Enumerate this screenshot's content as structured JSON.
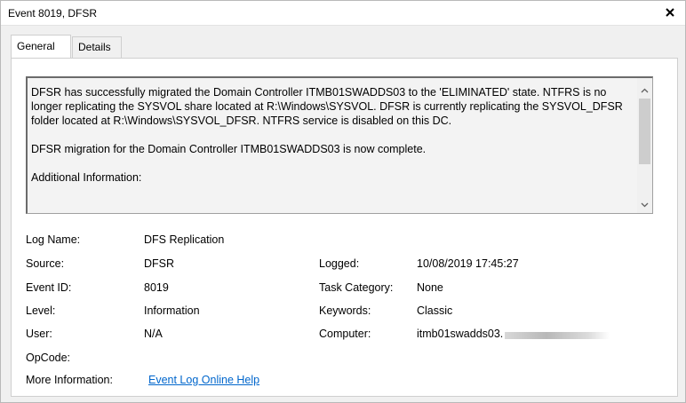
{
  "window": {
    "title": "Event 8019, DFSR"
  },
  "tabs": [
    {
      "label": "General",
      "active": true
    },
    {
      "label": "Details",
      "active": false
    }
  ],
  "description": {
    "paragraphs": [
      "DFSR has successfully migrated the Domain Controller ITMB01SWADDS03 to the 'ELIMINATED' state. NTFRS is no longer replicating the SYSVOL share located at R:\\Windows\\SYSVOL. DFSR is currently replicating the SYSVOL_DFSR folder located at R:\\Windows\\SYSVOL_DFSR. NTFRS service is disabled on this DC.",
      "DFSR migration for the Domain Controller ITMB01SWADDS03 is now complete.",
      "Additional Information:"
    ]
  },
  "fields": {
    "log_name": {
      "label": "Log Name:",
      "value": "DFS Replication"
    },
    "source": {
      "label": "Source:",
      "value": "DFSR"
    },
    "logged": {
      "label": "Logged:",
      "value": "10/08/2019 17:45:27"
    },
    "event_id": {
      "label": "Event ID:",
      "value": "8019"
    },
    "task_category": {
      "label": "Task Category:",
      "value": "None"
    },
    "level": {
      "label": "Level:",
      "value": "Information"
    },
    "keywords": {
      "label": "Keywords:",
      "value": "Classic"
    },
    "user": {
      "label": "User:",
      "value": "N/A"
    },
    "computer": {
      "label": "Computer:",
      "value": "itmb01swadds03."
    },
    "opcode": {
      "label": "OpCode:",
      "value": ""
    },
    "more_info": {
      "label": "More Information:",
      "link": "Event Log Online Help"
    }
  },
  "icons": {
    "close": "close-icon",
    "scroll_up": "chevron-up-icon",
    "scroll_down": "chevron-down-icon"
  }
}
